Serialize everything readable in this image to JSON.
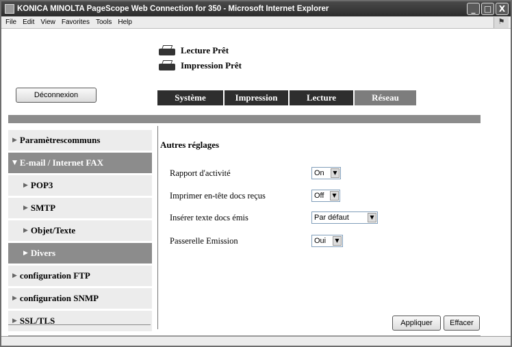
{
  "window": {
    "title": "KONICA MINOLTA PageScope Web Connection for 350 - Microsoft Internet Explorer",
    "controls": [
      "_",
      "□",
      "X"
    ]
  },
  "menubar": {
    "items": [
      "File",
      "Edit",
      "View",
      "Favorites",
      "Tools",
      "Help"
    ]
  },
  "status": {
    "scan": "Lecture Prêt",
    "print": "Impression Prêt"
  },
  "logout_label": "Déconnexion",
  "tabs": [
    "Système",
    "Impression",
    "Lecture",
    "Réseau"
  ],
  "sidebar": {
    "items": [
      {
        "label": "Paramètrescommuns"
      },
      {
        "label": "E-mail / Internet FAX"
      },
      {
        "label": "POP3"
      },
      {
        "label": "SMTP"
      },
      {
        "label": "Objet/Texte"
      },
      {
        "label": "Divers"
      },
      {
        "label": "configuration FTP"
      },
      {
        "label": "configuration SNMP"
      },
      {
        "label": "SSL/TLS"
      }
    ]
  },
  "main": {
    "title": "Autres réglages",
    "fields": [
      {
        "label": "Rapport d'activité",
        "value": "On"
      },
      {
        "label": "Imprimer en-tête docs reçus",
        "value": "Off"
      },
      {
        "label": "Insérer texte docs émis",
        "value": "Par défaut"
      },
      {
        "label": "Passerelle Emission",
        "value": "Oui"
      }
    ],
    "apply_label": "Appliquer",
    "clear_label": "Effacer"
  },
  "colors": {
    "tab_dark": "#2e2e2e",
    "tab_active": "#7d7d7d",
    "sidebar_bg": "#ececec",
    "sidebar_selected": "#8c8c8c"
  }
}
